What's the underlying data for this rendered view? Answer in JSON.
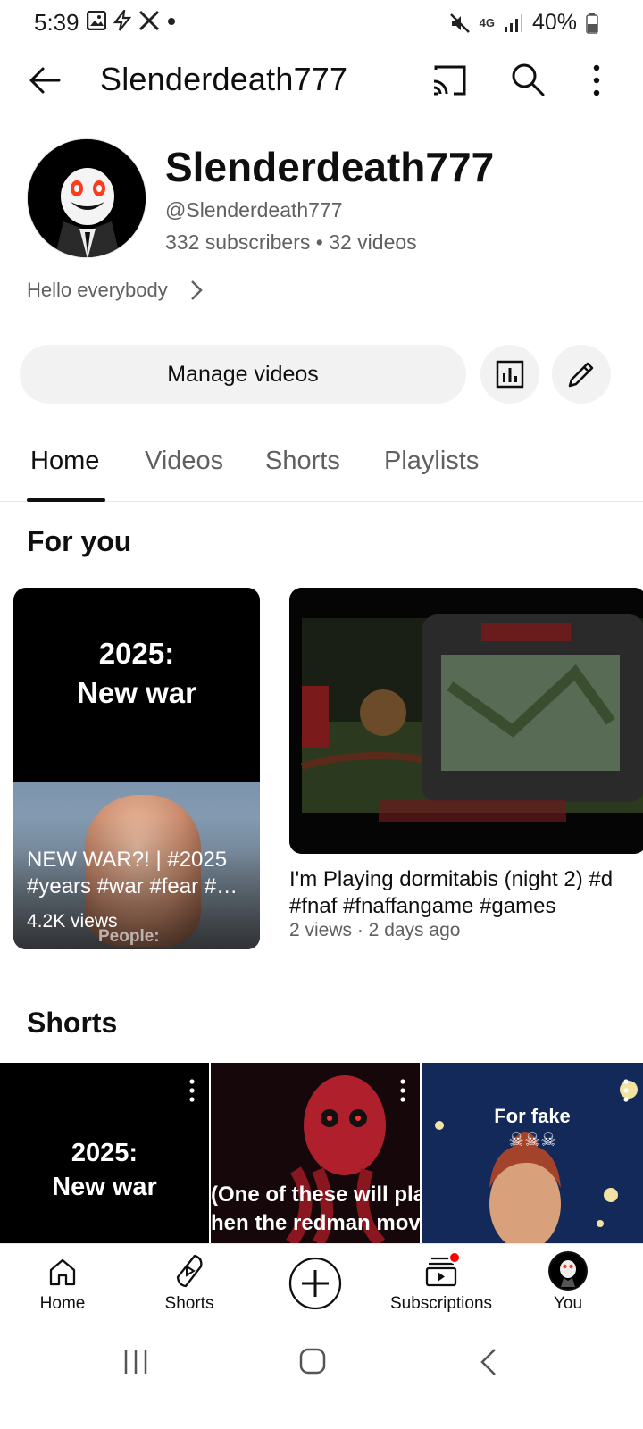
{
  "status_bar": {
    "time": "5:39",
    "network": "4G",
    "battery": "40%"
  },
  "app_bar": {
    "title": "Slenderdeath777",
    "icons": [
      "back-arrow-icon",
      "cast-icon",
      "search-icon",
      "more-vert-icon"
    ]
  },
  "channel": {
    "name": "Slenderdeath777",
    "handle": "@Slenderdeath777",
    "stats": "332 subscribers • 32 videos",
    "description": "Hello everybody"
  },
  "actions": {
    "manage_videos": "Manage videos",
    "icons": [
      "analytics-icon",
      "edit-pencil-icon"
    ]
  },
  "tabs": [
    {
      "label": "Home",
      "active": true
    },
    {
      "label": "Videos",
      "active": false
    },
    {
      "label": "Shorts",
      "active": false
    },
    {
      "label": "Playlists",
      "active": false
    }
  ],
  "for_you": {
    "title": "For you",
    "items": [
      {
        "thumb_text": "2025:\nNew war",
        "title": "NEW WAR?! | #2025 #years #war #fear #…",
        "views": "4.2K views",
        "overlay_caption": "People:"
      },
      {
        "title_line1": "I'm Playing dormitabis (night 2) #d",
        "title_line2": "#fnaf #fnaffangame #games",
        "meta": "2 views · 2 days ago"
      }
    ]
  },
  "shorts": {
    "title": "Shorts",
    "items": [
      {
        "thumb_text": "2025:\nNew war"
      },
      {
        "thumb_text_line1": "(One of these will play",
        "thumb_text_line2": "hen the redman moves"
      },
      {
        "thumb_text": "For fake"
      }
    ]
  },
  "bottom_nav": [
    {
      "label": "Home",
      "icon": "home-icon"
    },
    {
      "label": "Shorts",
      "icon": "shorts-icon"
    },
    {
      "label": "",
      "icon": "create-plus-icon"
    },
    {
      "label": "Subscriptions",
      "icon": "subscriptions-icon",
      "badge": true
    },
    {
      "label": "You",
      "icon": "avatar-icon"
    }
  ],
  "colors": {
    "text_primary": "#0f0f0f",
    "text_secondary": "#606060",
    "chip_bg": "#f2f2f2",
    "badge_red": "#ff0000"
  }
}
